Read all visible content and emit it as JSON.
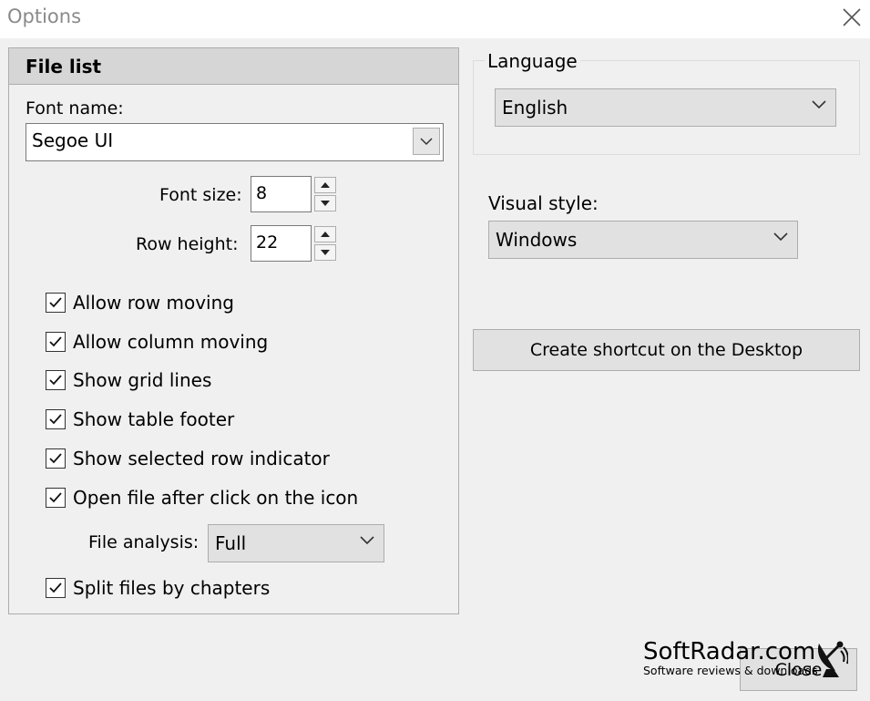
{
  "window": {
    "title": "Options",
    "close_icon": "close-icon"
  },
  "file_list": {
    "header": "File list",
    "font_name_label": "Font name:",
    "font_name_value": "Segoe UI",
    "font_size_label": "Font size:",
    "font_size_value": "8",
    "row_height_label": "Row height:",
    "row_height_value": "22",
    "checkboxes": [
      {
        "label": "Allow row moving",
        "checked": true
      },
      {
        "label": "Allow column moving",
        "checked": true
      },
      {
        "label": "Show grid lines",
        "checked": true
      },
      {
        "label": "Show table footer",
        "checked": true
      },
      {
        "label": "Show selected row indicator",
        "checked": true
      },
      {
        "label": "Open file after click on the icon",
        "checked": true
      },
      {
        "label": "Split files by chapters",
        "checked": true
      }
    ],
    "file_analysis_label": "File analysis:",
    "file_analysis_value": "Full"
  },
  "language": {
    "legend": "Language",
    "value": "English"
  },
  "visual_style": {
    "label": "Visual style:",
    "value": "Windows"
  },
  "shortcut_button": "Create shortcut on the Desktop",
  "close_button": "Close",
  "watermark": {
    "brand": "SoftRadar.com",
    "tagline": "Software reviews & downloads"
  }
}
